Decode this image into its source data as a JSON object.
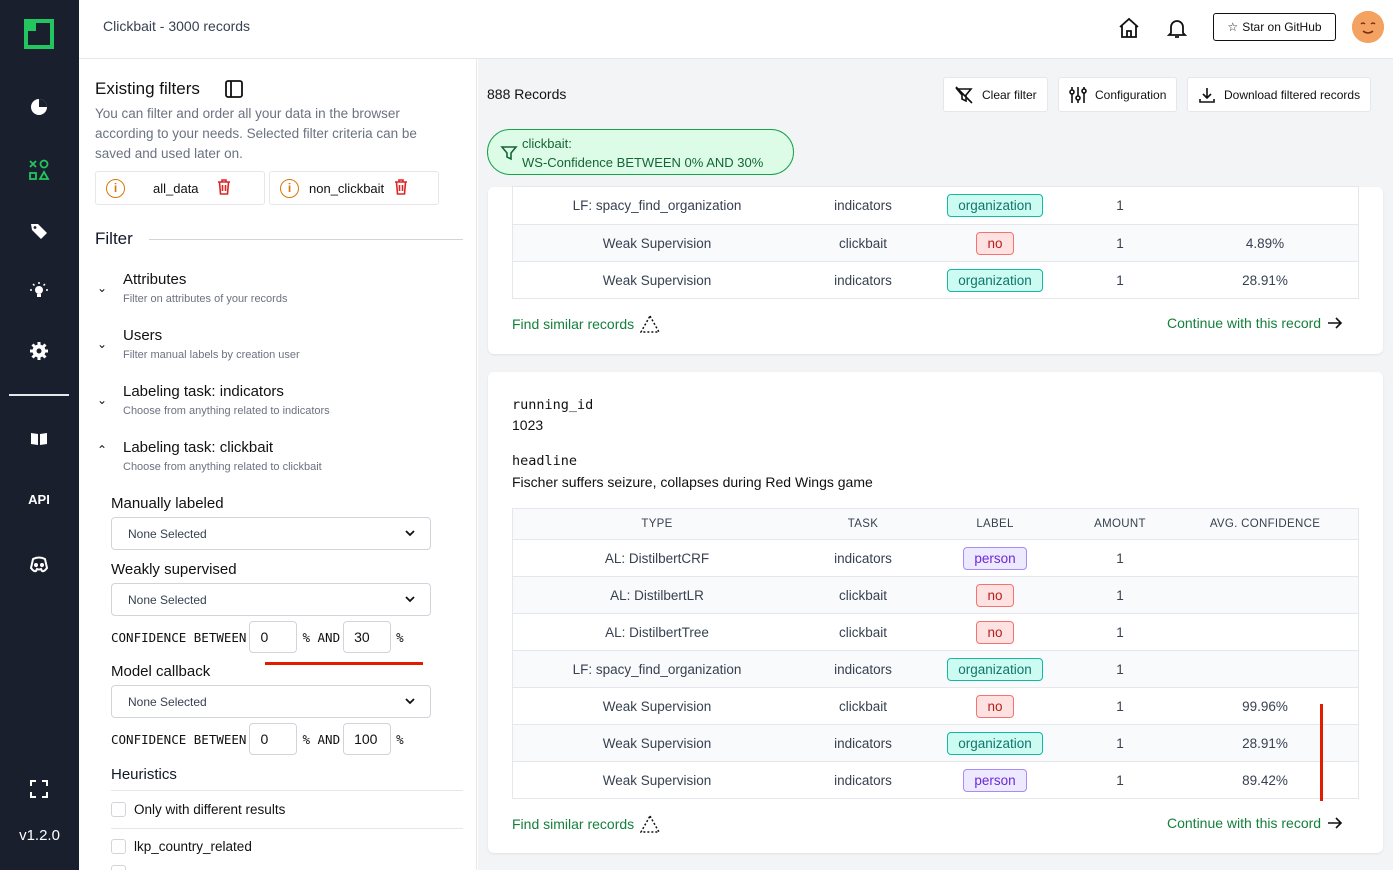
{
  "header": {
    "title": "Clickbait - 3000 records",
    "github_label": "Star on GitHub"
  },
  "sidebar": {
    "icons": [
      "logo-icon",
      "overview-icon",
      "labeling-icon",
      "tag-icon",
      "lightbulb-icon",
      "settings-icon",
      "book-icon",
      "api-icon",
      "discord-icon",
      "fullscreen-icon"
    ],
    "api_label": "API",
    "version": "v1.2.0"
  },
  "left_panel": {
    "existing_filters_title": "Existing filters",
    "existing_filters_desc": "You can filter and order all your data in the browser according to your needs. Selected filter criteria can be saved and used later on.",
    "saved_filters": [
      "all_data",
      "non_clickbait"
    ],
    "filter_title": "Filter",
    "sections": [
      {
        "title": "Attributes",
        "desc": "Filter on attributes of your records"
      },
      {
        "title": "Users",
        "desc": "Filter manual labels by creation user"
      },
      {
        "title": "Labeling task:  indicators",
        "desc": "Choose from anything related to indicators"
      },
      {
        "title": "Labeling task:  clickbait",
        "desc": "Choose from anything related to clickbait"
      }
    ],
    "manually_labeled": {
      "label": "Manually labeled",
      "value": "None Selected"
    },
    "weakly_supervised": {
      "label": "Weakly supervised",
      "value": "None Selected",
      "conf_label": "CONFIDENCE BETWEEN",
      "min": "0",
      "max": "30",
      "pct": "%",
      "and": "% AND"
    },
    "model_callback": {
      "label": "Model callback",
      "value": "None Selected",
      "conf_label": "CONFIDENCE BETWEEN",
      "min": "0",
      "max": "100",
      "pct": "%",
      "and": "% AND"
    },
    "heuristics": {
      "title": "Heuristics",
      "items": [
        "Only with different results",
        "lkp_country_related"
      ]
    }
  },
  "main": {
    "record_count": "888 Records",
    "buttons": {
      "clear": "Clear filter",
      "config": "Configuration",
      "download": "Download filtered records"
    },
    "filter_chip": {
      "line1": "clickbait:",
      "line2": "WS-Confidence BETWEEN 0% AND 30%"
    },
    "card1": {
      "rows": [
        {
          "type": "LF: spacy_find_organization",
          "task": "indicators",
          "label": "organization",
          "amount": "1",
          "conf": ""
        },
        {
          "type": "Weak Supervision",
          "task": "clickbait",
          "label": "no",
          "amount": "1",
          "conf": "4.89%"
        },
        {
          "type": "Weak Supervision",
          "task": "indicators",
          "label": "organization",
          "amount": "1",
          "conf": "28.91%"
        }
      ],
      "find_similar": "Find similar records",
      "continue": "Continue with this record"
    },
    "card2": {
      "field1_name": "running_id",
      "field1_value": "1023",
      "field2_name": "headline",
      "field2_value": "Fischer suffers seizure, collapses during Red Wings game",
      "columns": [
        "TYPE",
        "TASK",
        "LABEL",
        "AMOUNT",
        "AVG. CONFIDENCE"
      ],
      "rows": [
        {
          "type": "AL: DistilbertCRF",
          "task": "indicators",
          "label": "person",
          "amount": "1",
          "conf": ""
        },
        {
          "type": "AL: DistilbertLR",
          "task": "clickbait",
          "label": "no",
          "amount": "1",
          "conf": ""
        },
        {
          "type": "AL: DistilbertTree",
          "task": "clickbait",
          "label": "no",
          "amount": "1",
          "conf": ""
        },
        {
          "type": "LF: spacy_find_organization",
          "task": "indicators",
          "label": "organization",
          "amount": "1",
          "conf": ""
        },
        {
          "type": "Weak Supervision",
          "task": "clickbait",
          "label": "no",
          "amount": "1",
          "conf": "99.96%"
        },
        {
          "type": "Weak Supervision",
          "task": "indicators",
          "label": "organization",
          "amount": "1",
          "conf": "28.91%"
        },
        {
          "type": "Weak Supervision",
          "task": "indicators",
          "label": "person",
          "amount": "1",
          "conf": "89.42%"
        }
      ],
      "find_similar": "Find similar records",
      "continue": "Continue with this record"
    }
  },
  "colors": {
    "sidebar": "#1a1f2e",
    "accent_green": "#15803d",
    "logo_green": "#22c55e",
    "annotation_red": "#e11d00"
  }
}
